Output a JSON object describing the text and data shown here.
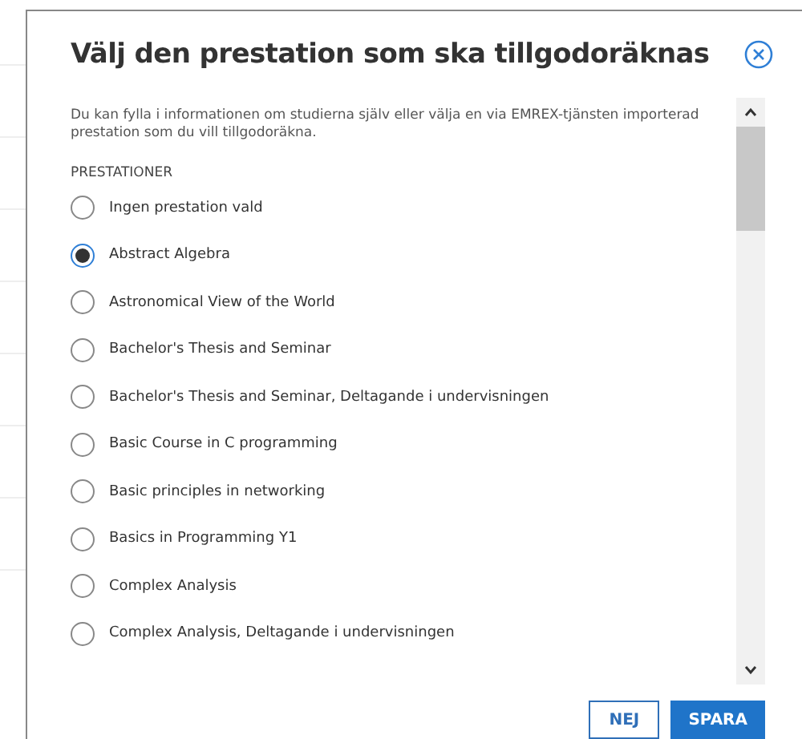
{
  "dialog": {
    "title": "Välj den prestation som ska tillgodoräknas",
    "description": "Du kan fylla i informationen om studierna själv eller välja en via EMREX-tjänsten importerad prestation som du vill tillgodoräkna.",
    "section_label": "PRESTATIONER",
    "options": [
      {
        "label": "Ingen prestation vald",
        "selected": false
      },
      {
        "label": "Abstract Algebra",
        "selected": true
      },
      {
        "label": "Astronomical View of the World",
        "selected": false
      },
      {
        "label": "Bachelor's Thesis and Seminar",
        "selected": false
      },
      {
        "label": "Bachelor's Thesis and Seminar, Deltagande i undervisningen",
        "selected": false
      },
      {
        "label": "Basic Course in C programming",
        "selected": false
      },
      {
        "label": "Basic principles in networking",
        "selected": false
      },
      {
        "label": "Basics in Programming Y1",
        "selected": false
      },
      {
        "label": "Complex Analysis",
        "selected": false
      },
      {
        "label": "Complex Analysis, Deltagande i undervisningen",
        "selected": false
      }
    ],
    "buttons": [
      {
        "label": "NEJ",
        "kind": "secondary"
      },
      {
        "label": "SPARA",
        "kind": "primary"
      }
    ]
  }
}
